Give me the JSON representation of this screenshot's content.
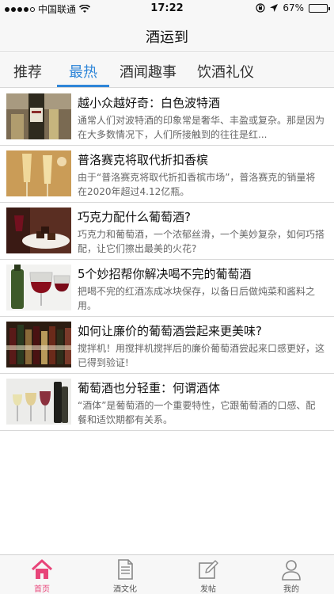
{
  "status_bar": {
    "carrier": "中国联通",
    "time": "17:22",
    "battery_text": "67%",
    "battery_level": 0.67,
    "signal_bars": 4
  },
  "nav": {
    "title": "酒运到"
  },
  "tabs": [
    {
      "label": "推荐",
      "active": false
    },
    {
      "label": "最热",
      "active": true
    },
    {
      "label": "酒闻趣事",
      "active": false
    },
    {
      "label": "饮酒礼仪",
      "active": false
    }
  ],
  "articles": [
    {
      "title": "越小众越好奇：白色波特酒",
      "desc": "通常人们对波特酒的印象常是奢华、丰盈或复杂。那是因为在大多数情况下，人们所接触到的往往是红...",
      "thumb": "white-port-bottle-image"
    },
    {
      "title": "普洛赛克将取代折扣香槟",
      "desc": "由于“普洛赛克将取代折扣香槟市场”，普洛赛克的销量将在2020年超过4.12亿瓶。",
      "thumb": "sparkling-wine-glasses-image"
    },
    {
      "title": "巧克力配什么葡萄酒?",
      "desc": "巧克力和葡萄酒，一个浓郁丝滑，一个美妙复杂，如何巧搭配，让它们擦出最美的火花?",
      "thumb": "chocolate-and-wine-image"
    },
    {
      "title": "5个妙招帮你解决喝不完的葡萄酒",
      "desc": "把喝不完的红酒冻成冰块保存，以备日后做炖菜和酱料之用。",
      "thumb": "red-wine-glasses-image"
    },
    {
      "title": "如何让廉价的葡萄酒尝起来更美味?",
      "desc": "搅拌机！用搅拌机搅拌后的廉价葡萄酒尝起来口感更好，这已得到验证!",
      "thumb": "wine-shelf-image"
    },
    {
      "title": "葡萄酒也分轻重：何谓酒体",
      "desc": "“酒体”是葡萄酒的一个重要特性，它跟葡萄酒的口感、配餐和适饮期都有关系。",
      "thumb": "wine-lineup-image"
    }
  ],
  "tab_bar": [
    {
      "label": "首页",
      "icon": "home-icon",
      "active": true
    },
    {
      "label": "酒文化",
      "icon": "document-icon",
      "active": false
    },
    {
      "label": "发帖",
      "icon": "compose-icon",
      "active": false
    },
    {
      "label": "我的",
      "icon": "person-icon",
      "active": false
    }
  ],
  "colors": {
    "accent_blue": "#2f86d8",
    "active_pink": "#e8457a",
    "bar_bg": "#f7f7f7"
  }
}
